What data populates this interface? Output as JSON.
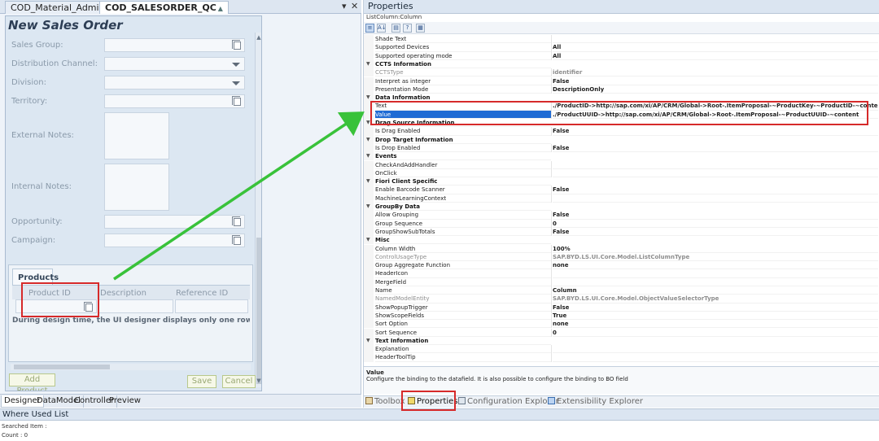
{
  "left": {
    "doc_tabs": [
      "COD_Material_Admin",
      "COD_SALESORDER_QC"
    ],
    "form_title": "New Sales Order",
    "fields": [
      {
        "label": "Sales Group:",
        "type": "input-value-help"
      },
      {
        "label": "Distribution Channel:",
        "type": "dropdown"
      },
      {
        "label": "Division:",
        "type": "dropdown"
      },
      {
        "label": "Territory:",
        "type": "input-value-help"
      },
      {
        "label": "External Notes:",
        "type": "textarea"
      },
      {
        "label": "Internal Notes:",
        "type": "textarea"
      },
      {
        "label": "Opportunity:",
        "type": "input-value-help"
      },
      {
        "label": "Campaign:",
        "type": "input-value-help"
      }
    ],
    "products": {
      "tab_label": "Products",
      "columns": [
        "Product ID",
        "Description",
        "Reference ID"
      ],
      "design_note": "During design time, the UI designer displays only one row in a list; dur"
    },
    "buttons": {
      "add_product": "Add Product",
      "save": "Save",
      "cancel": "Cancel"
    },
    "bottom_tabs": [
      "Designer",
      "DataModel",
      "Controller",
      "Preview"
    ]
  },
  "props": {
    "title": "Properties",
    "subtitle": "ListColumn:Column",
    "rows": [
      {
        "name": "Shade Text",
        "value": ""
      },
      {
        "name": "Supported Devices",
        "value": "All"
      },
      {
        "name": "Supported operating mode",
        "value": "All"
      },
      {
        "name": "CCTS Information",
        "cat": true
      },
      {
        "name": "CCTSType",
        "value": "identifier",
        "disabled": true
      },
      {
        "name": "Interpret as integer",
        "value": "False"
      },
      {
        "name": "Presentation Mode",
        "value": "DescriptionOnly"
      },
      {
        "name": "Data Information",
        "cat": true
      },
      {
        "name": "Text",
        "value": "./ProductID->http://sap.com/xi/AP/CRM/Global->Root-.ItemProposal-~ProductKey-~ProductID-~content"
      },
      {
        "name": "Value",
        "value": "./ProductUUID->http://sap.com/xi/AP/CRM/Global->Root-.ItemProposal-~ProductUUID-~content",
        "selected": true
      },
      {
        "name": "Drag Source Information",
        "cat": true
      },
      {
        "name": "Is Drag Enabled",
        "value": "False"
      },
      {
        "name": "Drop Target Information",
        "cat": true
      },
      {
        "name": "Is Drop Enabled",
        "value": "False"
      },
      {
        "name": "Events",
        "cat": true
      },
      {
        "name": "CheckAndAddHandler",
        "value": ""
      },
      {
        "name": "OnClick",
        "value": ""
      },
      {
        "name": "Fiori Client Specific",
        "cat": true
      },
      {
        "name": "Enable Barcode Scanner",
        "value": "False"
      },
      {
        "name": "MachineLearningContext",
        "value": ""
      },
      {
        "name": "GroupBy Data",
        "cat": true
      },
      {
        "name": "Allow Grouping",
        "value": "False"
      },
      {
        "name": "Group Sequence",
        "value": "0"
      },
      {
        "name": "GroupShowSubTotals",
        "value": "False"
      },
      {
        "name": "Misc",
        "cat": true
      },
      {
        "name": "Column Width",
        "value": "100%"
      },
      {
        "name": "ControlUsageType",
        "value": "SAP.BYD.LS.UI.Core.Model.ListColumnType",
        "disabled": true
      },
      {
        "name": "Group Aggregate Function",
        "value": "none"
      },
      {
        "name": "HeaderIcon",
        "value": ""
      },
      {
        "name": "MergeField",
        "value": ""
      },
      {
        "name": "Name",
        "value": "Column"
      },
      {
        "name": "NamedModelEntity",
        "value": "SAP.BYD.LS.UI.Core.Model.ObjectValueSelectorType",
        "disabled": true
      },
      {
        "name": "ShowPopupTrigger",
        "value": "False"
      },
      {
        "name": "ShowScopeFields",
        "value": "True"
      },
      {
        "name": "Sort Option",
        "value": "none"
      },
      {
        "name": "Sort Sequence",
        "value": "0"
      },
      {
        "name": "Text Information",
        "cat": true
      },
      {
        "name": "Explanation",
        "value": ""
      },
      {
        "name": "HeaderToolTip",
        "value": ""
      }
    ],
    "desc_title": "Value",
    "desc_text": "Configure the binding to the datafield. It is also possible to configure the binding to BO field",
    "bottom_tabs": [
      "Toolbox",
      "Properties",
      "Configuration Explorer",
      "Extensibility Explorer"
    ]
  },
  "where_used": {
    "title": "Where Used List",
    "searched_label": "Searched Item :",
    "count_label": "Count : 0"
  },
  "colors": {
    "annotation_red": "#d62a2a",
    "arrow_green": "#39c23a",
    "selection_blue": "#1f6bd4"
  }
}
